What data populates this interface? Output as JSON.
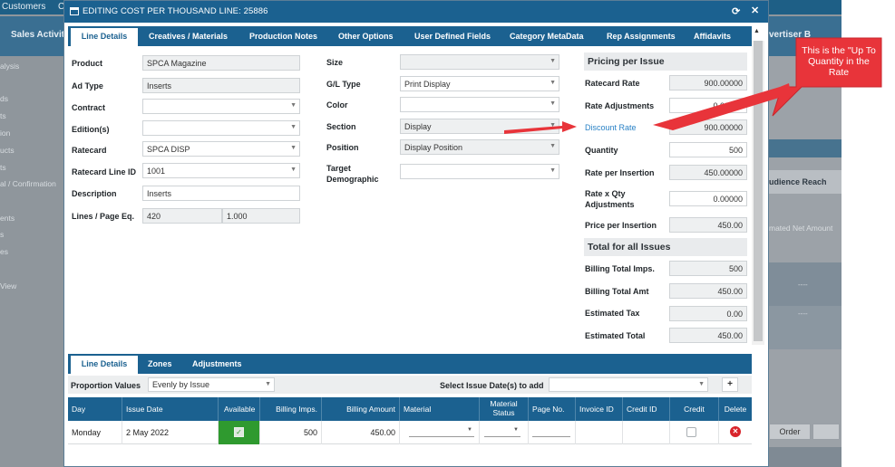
{
  "background": {
    "top_labels": [
      "Customers",
      "Cu"
    ],
    "nav_labels": [
      "Sales Activity",
      "vertiser B"
    ],
    "left_items": [
      "alysis",
      "ds",
      "ts",
      "ion",
      "ucts",
      "ts",
      "al / Confirmation",
      "ents",
      "s",
      "es",
      "View"
    ],
    "right_header": "udience Reach",
    "right_caption": "mated Net Amount",
    "right_dash1": "----",
    "right_dash2": "----",
    "right_order": "Order"
  },
  "dialog": {
    "title": "EDITING COST PER THOUSAND LINE: 25886",
    "refresh_glyph": "⟳",
    "close_glyph": "✕"
  },
  "tabs": [
    "Line Details",
    "Creatives / Materials",
    "Production Notes",
    "Other Options",
    "User Defined Fields",
    "Category MetaData",
    "Rep Assignments",
    "Affidavits"
  ],
  "left_form": {
    "product": {
      "label": "Product",
      "value": "SPCA Magazine"
    },
    "ad_type": {
      "label": "Ad Type",
      "value": "Inserts"
    },
    "contract": {
      "label": "Contract",
      "value": ""
    },
    "editions": {
      "label": "Edition(s)",
      "value": ""
    },
    "ratecard": {
      "label": "Ratecard",
      "value": "SPCA DISP"
    },
    "ratecard_line_id": {
      "label": "Ratecard Line ID",
      "value": "1001"
    },
    "description": {
      "label": "Description",
      "value": "Inserts"
    },
    "lines_page_eq": {
      "label": "Lines / Page Eq.",
      "value1": "420",
      "value2": "1.000"
    }
  },
  "mid_form": {
    "size": {
      "label": "Size",
      "value": ""
    },
    "gl_type": {
      "label": "G/L Type",
      "value": "Print Display"
    },
    "color": {
      "label": "Color",
      "value": ""
    },
    "section": {
      "label": "Section",
      "value": "Display"
    },
    "position": {
      "label": "Position",
      "value": "Display Position"
    },
    "target_demo": {
      "label1": "Target",
      "label2": "Demographic",
      "value": ""
    }
  },
  "pricing": {
    "header": "Pricing per Issue",
    "ratecard_rate": {
      "label": "Ratecard Rate",
      "value": "900.00000"
    },
    "rate_adjustments": {
      "label": "Rate Adjustments",
      "value": "0.00000"
    },
    "discount_rate": {
      "label": "Discount Rate",
      "value": "900.00000"
    },
    "quantity": {
      "label": "Quantity",
      "value": "500"
    },
    "rate_per_insertion": {
      "label": "Rate per Insertion",
      "value": "450.00000"
    },
    "rate_x_qty": {
      "label1": "Rate x Qty",
      "label2": "Adjustments",
      "value": "0.00000"
    },
    "price_per_insertion": {
      "label": "Price per Insertion",
      "value": "450.00"
    }
  },
  "totals": {
    "header": "Total for all Issues",
    "billing_total_imps": {
      "label": "Billing Total Imps.",
      "value": "500"
    },
    "billing_total_amt": {
      "label": "Billing Total Amt",
      "value": "450.00"
    },
    "estimated_tax": {
      "label": "Estimated Tax",
      "value": "0.00"
    },
    "estimated_total": {
      "label": "Estimated Total",
      "value": "450.00"
    }
  },
  "bottom_tabs": [
    "Line Details",
    "Zones",
    "Adjustments"
  ],
  "bottom_toolbar": {
    "proportion_label": "Proportion Values",
    "proportion_value": "Evenly by Issue",
    "issue_date_label": "Select Issue Date(s) to add",
    "issue_date_value": "",
    "add_glyph": "+"
  },
  "grid": {
    "headers": [
      "Day",
      "Issue Date",
      "Available",
      "Billing Imps.",
      "Billing Amount",
      "Material",
      "Material",
      "Status",
      "Page No.",
      "Invoice ID",
      "Credit ID",
      "Credit",
      "Delete"
    ],
    "row": {
      "day": "Monday",
      "issue_date": "2 May 2022",
      "available_glyph": "✓",
      "billing_imps": "500",
      "billing_amount": "450.00",
      "delete_glyph": "✕"
    }
  },
  "callout": {
    "text": "This is the \"Up To Quantity in the Rate"
  },
  "colors": {
    "primary": "#1b6190",
    "arrow": "#e8343a",
    "available_green": "#2f9a2f",
    "link_blue": "#2a82c6"
  }
}
